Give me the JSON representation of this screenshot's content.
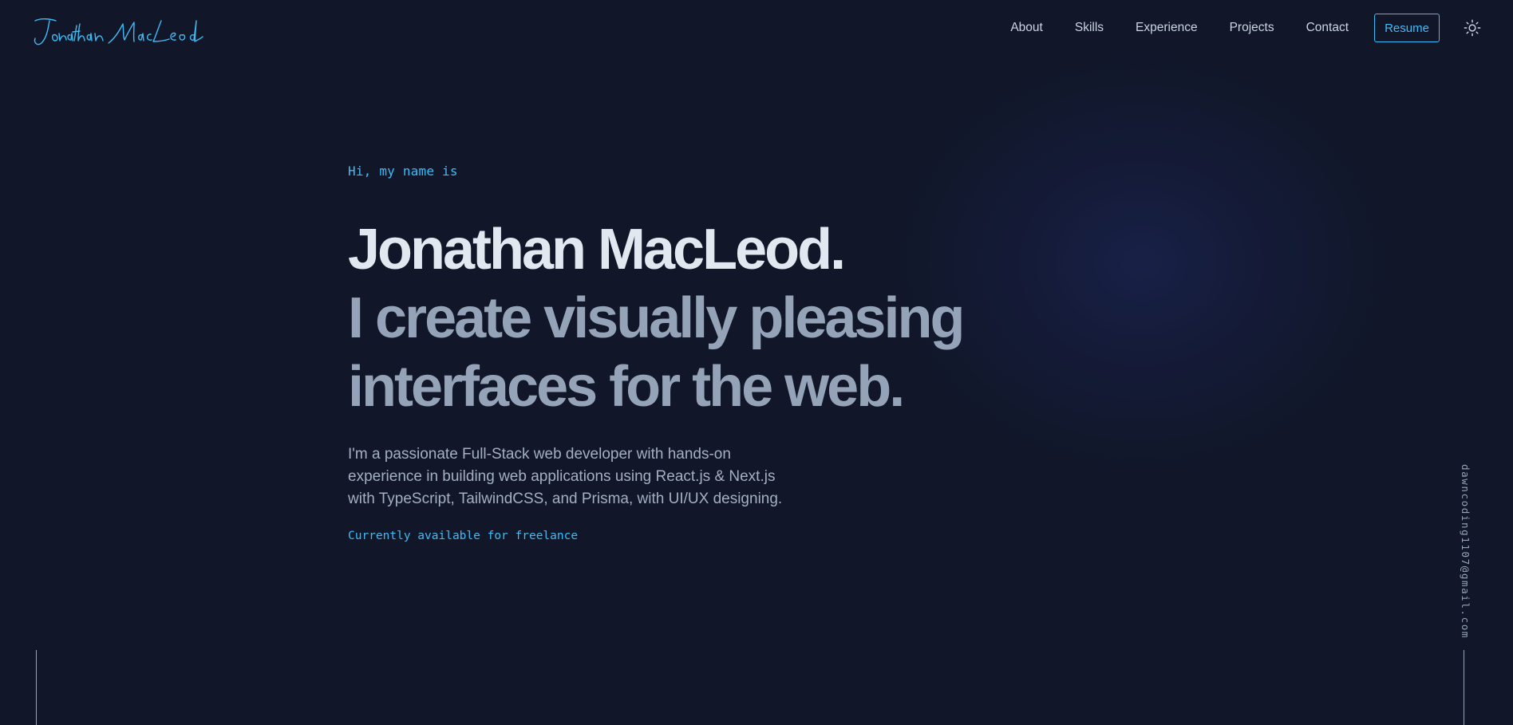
{
  "header": {
    "logo_text": "Jonathan MacLeod",
    "nav": [
      {
        "label": "About"
      },
      {
        "label": "Skills"
      },
      {
        "label": "Experience"
      },
      {
        "label": "Projects"
      },
      {
        "label": "Contact"
      }
    ],
    "resume_label": "Resume",
    "theme_icon": "sun-icon"
  },
  "hero": {
    "greeting": "Hi, my name is",
    "name": "Jonathan MacLeod.",
    "tagline_line1": "I create visually pleasing",
    "tagline_line2": "interfaces for the web.",
    "bio": "I'm a passionate Full-Stack web developer with hands-on experience in building web applications using React.js & Next.js with TypeScript, TailwindCSS, and Prisma, with UI/UX designing.",
    "availability": "Currently available for freelance"
  },
  "sidebar": {
    "email": "dawncoding1107@gmail.com"
  },
  "colors": {
    "background": "#111729",
    "accent": "#38bdf8",
    "heading": "#e2e8f0",
    "muted": "#94a3b8"
  }
}
